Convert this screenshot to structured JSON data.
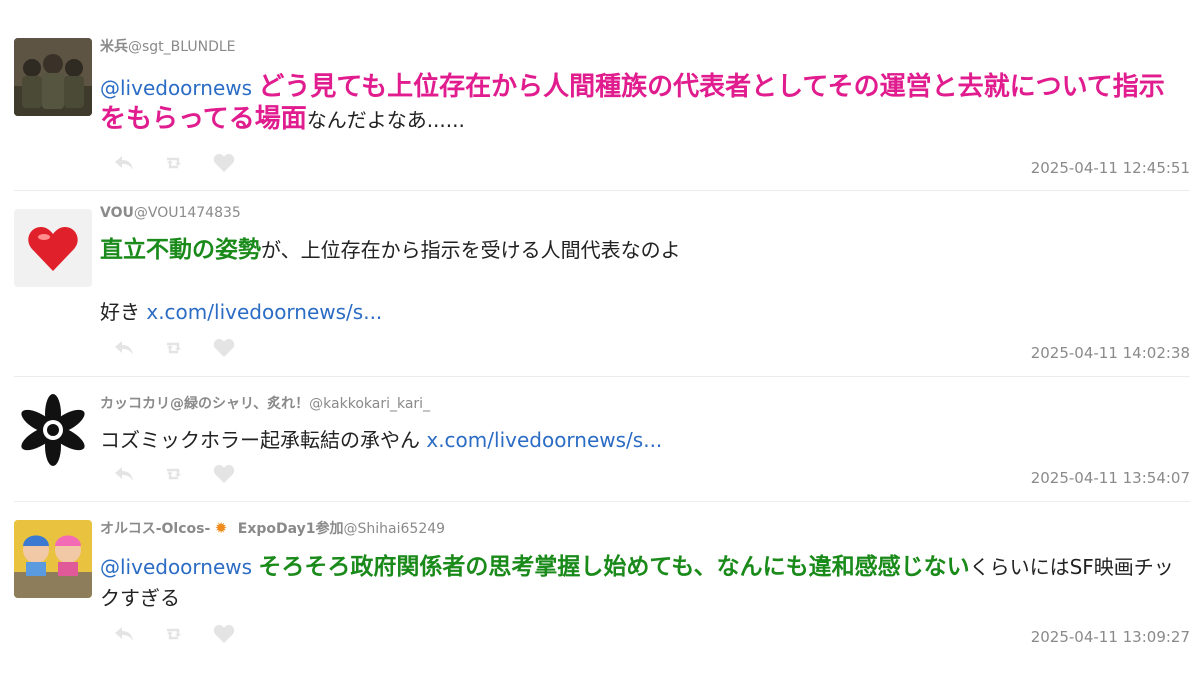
{
  "tweets": [
    {
      "name": "米兵",
      "handle": "@sgt_BLUNDLE",
      "body_mention": "@livedoornews",
      "body_highlight": "どう見ても上位存在から人間種族の代表者としてその運営と去就について指示をもらってる場面",
      "body_after": "なんだよなあ......",
      "time": "2025-04-11 12:45:51"
    },
    {
      "name": "VOU",
      "handle": "@VOU1474835",
      "body_highlight": "直立不動の姿勢",
      "body_after": "が、上位存在から指示を受ける人間代表なのよ",
      "body_line2": "好き",
      "link": "x.com/livedoornews/s...",
      "time": "2025-04-11 14:02:38"
    },
    {
      "name": "カッコカリ@緑のシャリ、炙れ！",
      "handle": "@kakkokari_kari_",
      "body_text": "コズミックホラー起承転結の承やん",
      "link": "x.com/livedoornews/s...",
      "time": "2025-04-11 13:54:07"
    },
    {
      "name": "オルコス-Olcos-",
      "name_suffix": "ExpoDay1参加",
      "handle": "@Shihai65249",
      "body_mention": "@livedoornews",
      "body_highlight": "そろそろ政府関係者の思考掌握し始めても、なんにも違和感感じない",
      "body_after": "くらいにはSF映画チックすぎる",
      "time": "2025-04-11 13:09:27"
    }
  ],
  "icons": {
    "reply": "reply-icon",
    "retweet": "retweet-icon",
    "like": "heart-icon"
  },
  "colors": {
    "highlight_pink": "#e01c8e",
    "highlight_green": "#1a8a1a",
    "link": "#2b6cc4",
    "meta": "#8a8a8a"
  }
}
